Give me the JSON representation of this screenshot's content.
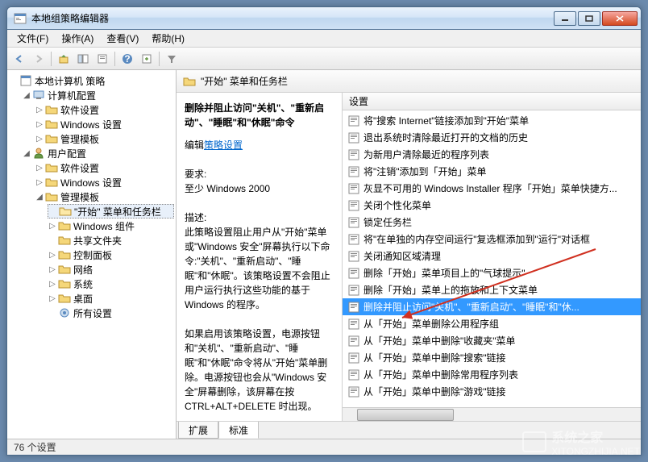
{
  "window": {
    "title": "本地组策略编辑器"
  },
  "menu": {
    "file": "文件(F)",
    "action": "操作(A)",
    "view": "查看(V)",
    "help": "帮助(H)"
  },
  "tree": {
    "root": "本地计算机 策略",
    "computer_config": "计算机配置",
    "cc_software": "软件设置",
    "cc_windows": "Windows 设置",
    "cc_admin": "管理模板",
    "user_config": "用户配置",
    "uc_software": "软件设置",
    "uc_windows": "Windows 设置",
    "uc_admin": "管理模板",
    "start_taskbar": "\"开始\" 菜单和任务栏",
    "win_components": "Windows 组件",
    "shared_folders": "共享文件夹",
    "control_panel": "控制面板",
    "network": "网络",
    "system": "系统",
    "desktop": "桌面",
    "all_settings": "所有设置"
  },
  "header": {
    "folder": "\"开始\" 菜单和任务栏"
  },
  "desc": {
    "title": "删除并阻止访问\"关机\"、\"重新启动\"、\"睡眠\"和\"休眠\"命令",
    "edit_label": "编辑",
    "edit_link": "策略设置",
    "req_label": "要求:",
    "req_text": "至少 Windows 2000",
    "desc_label": "描述:",
    "desc_p1": "此策略设置阻止用户从\"开始\"菜单或\"Windows 安全\"屏幕执行以下命令:\"关机\"、\"重新启动\"、\"睡眠\"和\"休眠\"。该策略设置不会阻止用户运行执行这些功能的基于 Windows 的程序。",
    "desc_p2": "如果启用该策略设置，电源按钮和\"关机\"、\"重新启动\"、\"睡眠\"和\"休眠\"命令将从\"开始\"菜单删除。电源按钮也会从\"Windows 安全\"屏幕删除，该屏幕在按 CTRL+ALT+DELETE 时出现。"
  },
  "col": {
    "settings": "设置"
  },
  "settings": [
    "将\"搜索 Internet\"链接添加到\"开始\"菜单",
    "退出系统时清除最近打开的文档的历史",
    "为新用户清除最近的程序列表",
    "将\"注销\"添加到「开始」菜单",
    "灰显不可用的 Windows Installer 程序「开始」菜单快捷方...",
    "关闭个性化菜单",
    "锁定任务栏",
    "将\"在单独的内存空间运行\"复选框添加到\"运行\"对话框",
    "关闭通知区域清理",
    "删除「开始」菜单项目上的\"气球提示\"",
    "删除「开始」菜单上的拖放和上下文菜单",
    "删除并阻止访问\"关机\"、\"重新启动\"、\"睡眠\"和\"休...",
    "从「开始」菜单删除公用程序组",
    "从「开始」菜单中删除\"收藏夹\"菜单",
    "从「开始」菜单中删除\"搜索\"链接",
    "从「开始」菜单中删除常用程序列表",
    "从「开始」菜单中删除\"游戏\"链接"
  ],
  "selected_index": 11,
  "tabs": {
    "extended": "扩展",
    "standard": "标准"
  },
  "status": {
    "count": "76 个设置"
  },
  "watermark": {
    "text1": "系统之家",
    "text2": "XITONGZHIJIA.NET"
  }
}
